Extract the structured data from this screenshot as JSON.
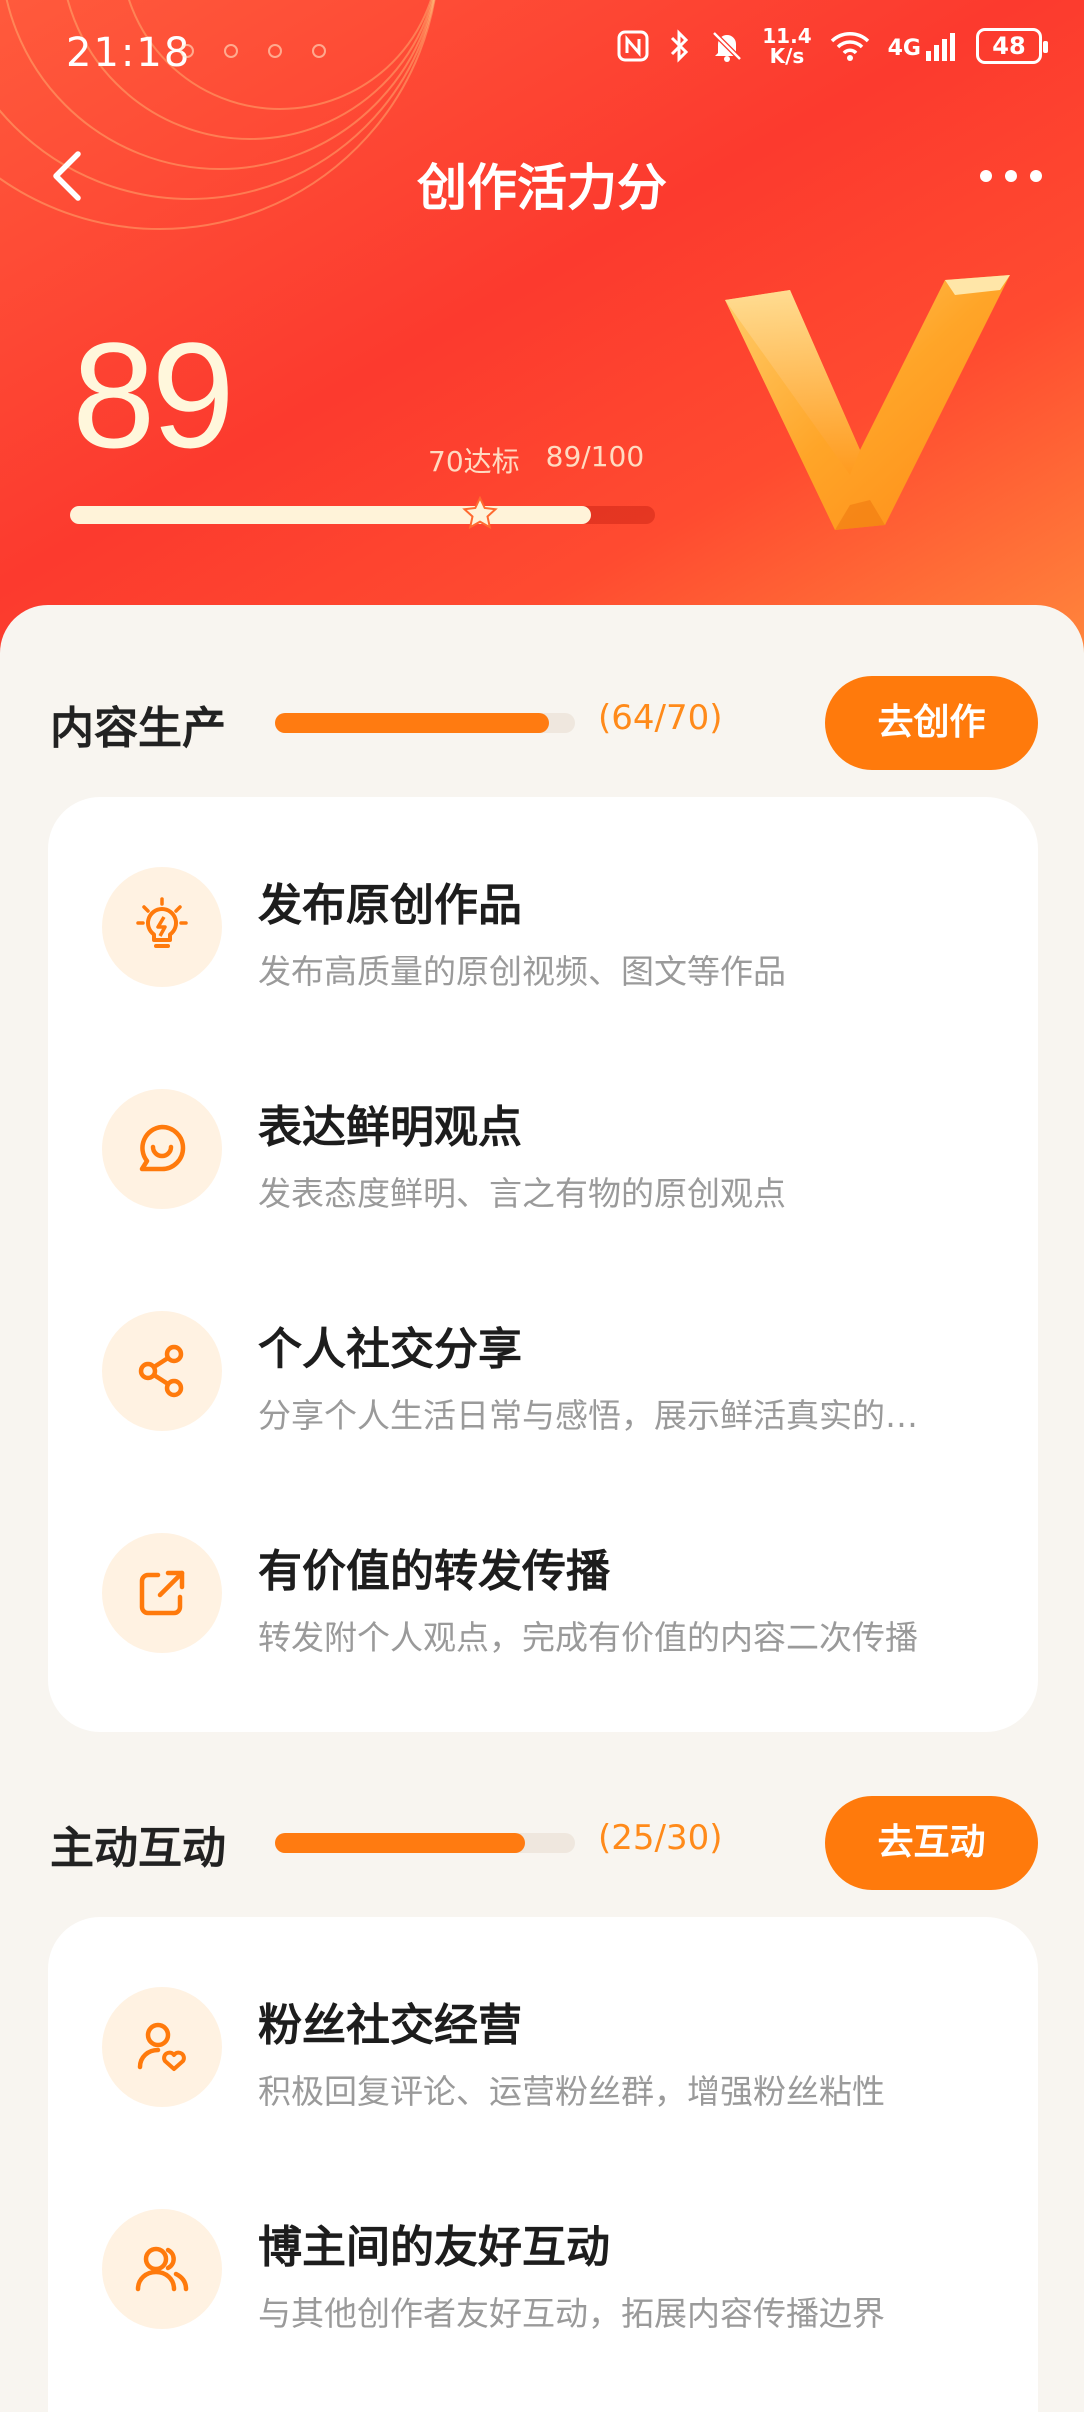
{
  "status_bar": {
    "time": "21:18",
    "net_speed_value": "11.4",
    "net_speed_unit": "K/s",
    "network": "4G",
    "battery": "48"
  },
  "header": {
    "title": "创作活力分"
  },
  "score": {
    "value": "89",
    "target_label": "70达标",
    "progress_label": "89/100",
    "progress_fraction": 0.89,
    "target_fraction": 0.7
  },
  "sections": [
    {
      "title": "内容生产",
      "count": "(64/70)",
      "progress_fraction": 0.914,
      "button_label": "去创作",
      "items": [
        {
          "icon": "lightbulb-icon",
          "title": "发布原创作品",
          "desc": "发布高质量的原创视频、图文等作品"
        },
        {
          "icon": "chat-bubble-icon",
          "title": "表达鲜明观点",
          "desc": "发表态度鲜明、言之有物的原创观点"
        },
        {
          "icon": "share-icon",
          "title": "个人社交分享",
          "desc": "分享个人生活日常与感悟，展示鲜活真实的…"
        },
        {
          "icon": "forward-icon",
          "title": "有价值的转发传播",
          "desc": "转发附个人观点，完成有价值的内容二次传播"
        }
      ]
    },
    {
      "title": "主动互动",
      "count": "(25/30)",
      "progress_fraction": 0.833,
      "button_label": "去互动",
      "items": [
        {
          "icon": "fan-heart-icon",
          "title": "粉丝社交经营",
          "desc": "积极回复评论、运营粉丝群，增强粉丝粘性"
        },
        {
          "icon": "users-icon",
          "title": "博主间的友好互动",
          "desc": "与其他创作者友好互动，拓展内容传播边界"
        }
      ]
    }
  ],
  "colors": {
    "accent": "#ff7a0c",
    "hero_red": "#fc3a2e",
    "score_cream": "#fff7dc"
  }
}
